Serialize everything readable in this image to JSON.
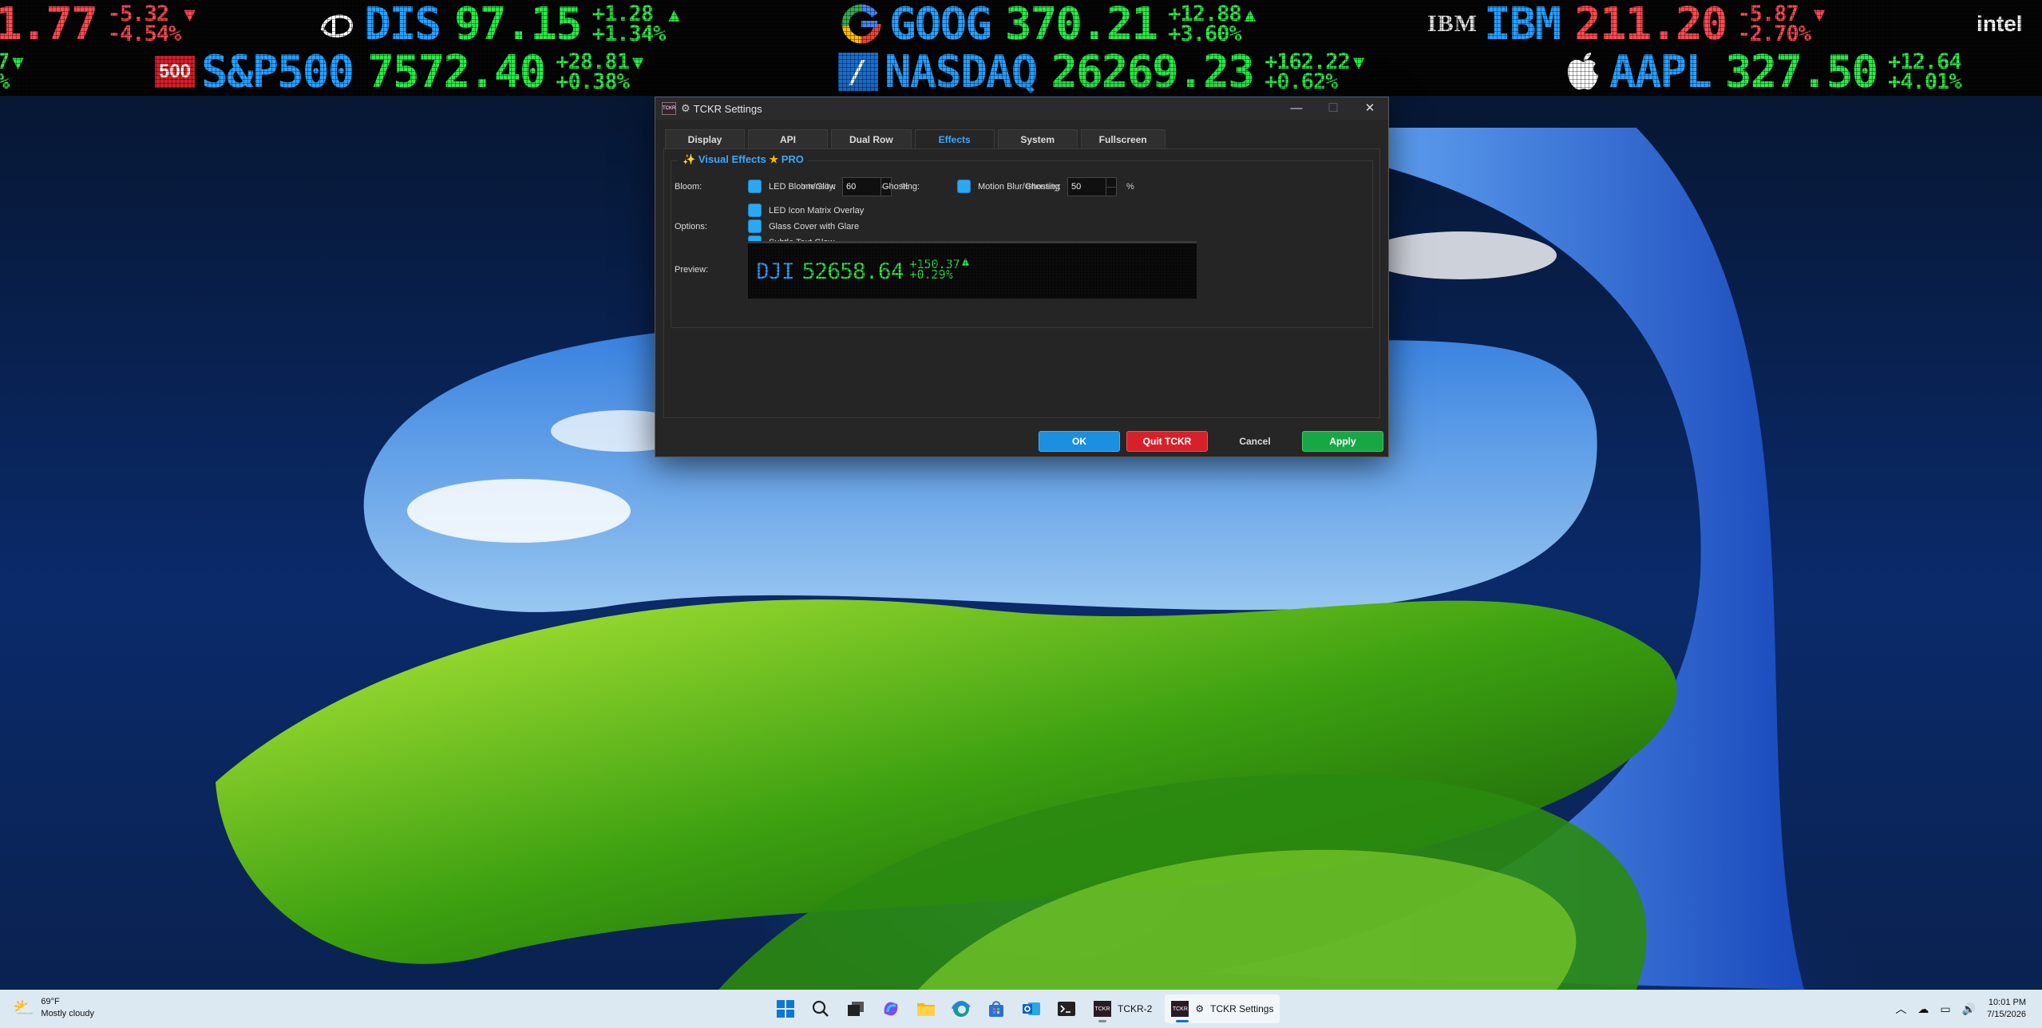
{
  "ticker_top": [
    {
      "symbol": "",
      "price": "1.77",
      "change": "-5.32",
      "change_pct": "-4.54%",
      "dir": "down"
    },
    {
      "logo": "disney-logo",
      "symbol": "DIS",
      "price": "97.15",
      "change": "+1.28",
      "change_pct": "+1.34%",
      "dir": "up"
    },
    {
      "logo": "google-logo",
      "symbol": "GOOG",
      "price": "370.21",
      "change": "+12.88",
      "change_pct": "+3.60%",
      "dir": "up"
    },
    {
      "logo": "ibm-logo",
      "logo_text": "IBM",
      "symbol": "IBM",
      "price": "211.20",
      "change": "-5.87",
      "change_pct": "-2.70%",
      "dir": "down"
    },
    {
      "logo": "intel-logo",
      "logo_text": "intel"
    }
  ],
  "ticker_bottom": [
    {
      "change": "7",
      "change_pct": "%",
      "dir": "up"
    },
    {
      "logo": "sp500-logo",
      "logo_text": "500",
      "symbol": "S&P500",
      "price": "7572.40",
      "change": "+28.81",
      "change_pct": "+0.38%",
      "dir": "up"
    },
    {
      "logo": "nasdaq-logo",
      "symbol": "NASDAQ",
      "price": "26269.23",
      "change": "+162.22",
      "change_pct": "+0.62%",
      "dir": "up"
    },
    {
      "logo": "apple-logo",
      "symbol": "AAPL",
      "price": "327.50",
      "change": "+12.64",
      "change_pct": "+4.01%",
      "dir": "up"
    }
  ],
  "dialog": {
    "title": "TCKR Settings",
    "app_icon_text": "TCKR",
    "tabs": [
      "Display",
      "API",
      "Dual Row",
      "Effects",
      "System",
      "Fullscreen"
    ],
    "active_tab": "Effects",
    "group_title": "Visual Effects",
    "group_badge": "PRO",
    "bloom_label": "Bloom:",
    "bloom_checkbox": "LED Bloom/Glow",
    "intensity_label": "Intensity:",
    "bloom_intensity": "60",
    "percent": "%",
    "ghosting_label": "Ghosting:",
    "ghosting_checkbox": "Motion Blur/Ghosting",
    "ghosting_intensity": "50",
    "options_label": "Options:",
    "options": [
      "LED Icon Matrix Overlay",
      "Glass Cover with Glare",
      "Subtle Text Glow"
    ],
    "preview_label": "Preview:",
    "preview": {
      "symbol": "DJI",
      "price": "52658.64",
      "change": "+150.37",
      "change_pct": "+0.29%"
    },
    "buttons": {
      "ok": "OK",
      "quit": "Quit TCKR",
      "cancel": "Cancel",
      "apply": "Apply"
    }
  },
  "taskbar": {
    "weather_temp": "69°F",
    "weather_desc": "Mostly cloudy",
    "apps": [
      {
        "label": "TCKR-2",
        "icon_text": "TCKR",
        "active": false
      },
      {
        "label": "TCKR Settings",
        "icon_text": "TCKR",
        "active": true
      }
    ],
    "time": "10:01 PM",
    "date": "7/15/2026"
  },
  "colors": {
    "up": "#2ee84a",
    "down": "#ff4a52",
    "symbol_blue": "#2aa0ff",
    "accent": "#3aa8ff",
    "ok": "#1b8fe0",
    "quit": "#d8202a",
    "apply": "#17a845"
  }
}
